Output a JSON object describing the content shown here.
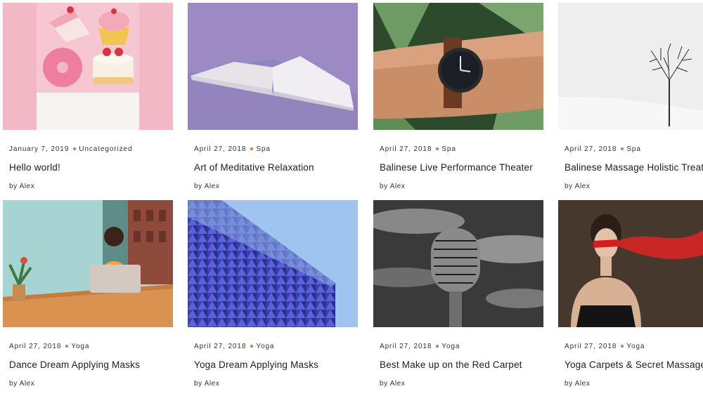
{
  "posts": [
    {
      "date": "January 7, 2019",
      "category": "Uncategorized",
      "title": "Hello world!",
      "by": "by",
      "author": "Alex",
      "image": "desserts-pink"
    },
    {
      "date": "April 27, 2018",
      "category": "Spa",
      "title": "Art of Meditative Relaxation",
      "by": "by",
      "author": "Alex",
      "image": "open-book-purple"
    },
    {
      "date": "April 27, 2018",
      "category": "Spa",
      "title": "Balinese Live Performance Theater",
      "by": "by",
      "author": "Alex",
      "image": "wristwatch-leaves"
    },
    {
      "date": "April 27, 2018",
      "category": "Spa",
      "title": "Balinese Massage Holistic Treatment",
      "by": "by",
      "author": "Alex",
      "image": "lone-tree-snow"
    },
    {
      "date": "April 27, 2018",
      "category": "Yoga",
      "title": "Dance Dream Applying Masks",
      "by": "by",
      "author": "Alex",
      "image": "woman-laptop"
    },
    {
      "date": "April 27, 2018",
      "category": "Yoga",
      "title": "Yoga Dream Applying Masks",
      "by": "by",
      "author": "Alex",
      "image": "blue-building"
    },
    {
      "date": "April 27, 2018",
      "category": "Yoga",
      "title": "Best Make up on the Red Carpet",
      "by": "by",
      "author": "Alex",
      "image": "microphone"
    },
    {
      "date": "April 27, 2018",
      "category": "Yoga",
      "title": "Yoga Carpets & Secret Massages",
      "by": "by",
      "author": "Alex",
      "image": "red-ribbon-woman"
    }
  ],
  "colors": {
    "accent": "#e2733a",
    "text": "#222222"
  }
}
